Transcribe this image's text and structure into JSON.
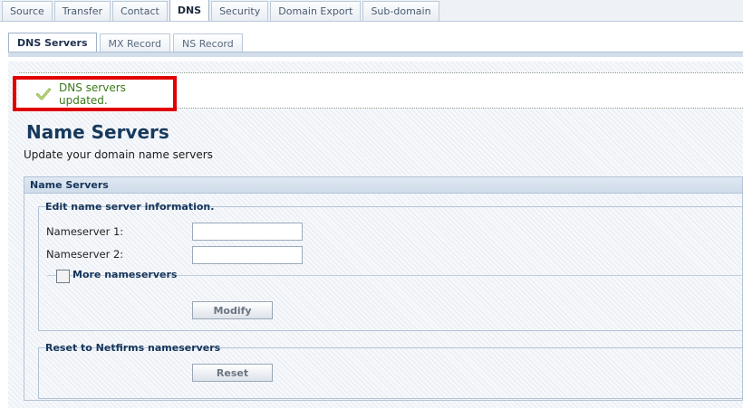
{
  "top_tabs": [
    {
      "label": "Source"
    },
    {
      "label": "Transfer"
    },
    {
      "label": "Contact"
    },
    {
      "label": "DNS",
      "active": true
    },
    {
      "label": "Security"
    },
    {
      "label": "Domain Export"
    },
    {
      "label": "Sub-domain"
    }
  ],
  "sub_tabs": [
    {
      "label": "DNS Servers",
      "active": true
    },
    {
      "label": "MX Record"
    },
    {
      "label": "NS Record"
    }
  ],
  "notice": {
    "text": "DNS servers updated.",
    "icon": "check-icon",
    "color": "#3a7a18",
    "highlight_color": "#e00000"
  },
  "page": {
    "title": "Name Servers",
    "subtitle": "Update your domain name servers"
  },
  "section": {
    "header": "Name Servers",
    "edit_legend": "Edit name server information.",
    "ns1_label": "Nameserver 1:",
    "ns1_value": "",
    "ns2_label": "Nameserver 2:",
    "ns2_value": "",
    "more_label": "More nameservers",
    "more_checked": false,
    "modify_label": "Modify",
    "reset_legend": "Reset to Netfirms nameservers",
    "reset_label": "Reset"
  },
  "colors": {
    "title": "#17395c",
    "tab_bar": "#eef2f7"
  }
}
